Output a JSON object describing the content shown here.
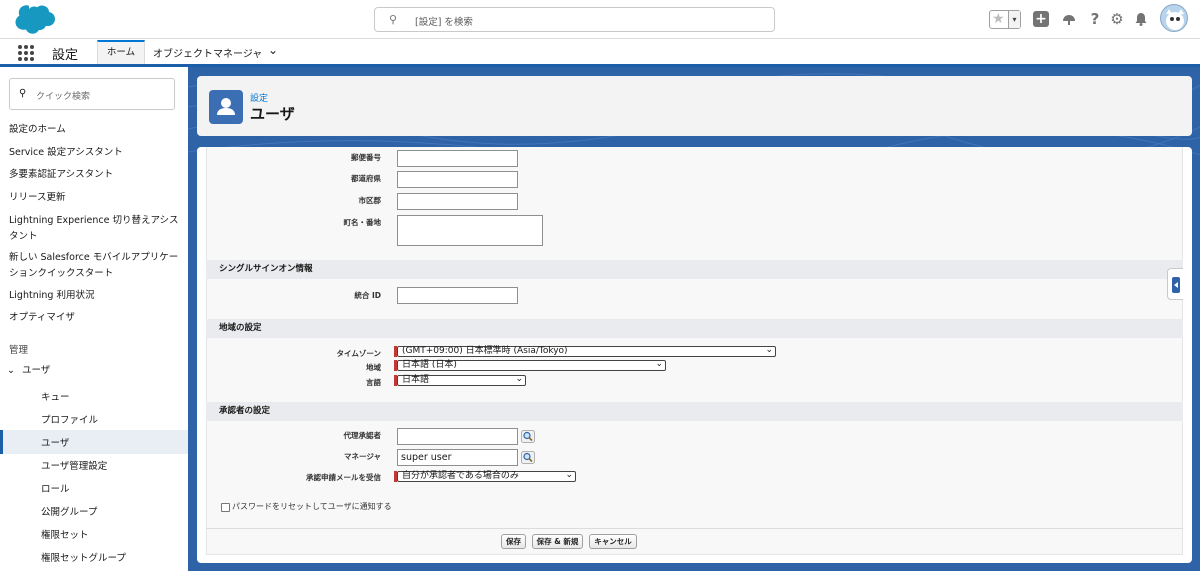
{
  "header": {
    "search_placeholder": "[設定] を検索",
    "icons": [
      "star-icon",
      "add-icon",
      "trailhead-icon",
      "help-icon",
      "gear-icon",
      "bell-icon",
      "avatar"
    ]
  },
  "navbar": {
    "app_name": "設定",
    "tabs": [
      {
        "label": "ホーム",
        "active": true
      },
      {
        "label": "オブジェクトマネージャ",
        "active": false
      }
    ]
  },
  "sidebar": {
    "search_placeholder": "クイック検索",
    "items": [
      {
        "label": "設定のホーム"
      },
      {
        "label": "Service 設定アシスタント"
      },
      {
        "label": "多要素認証アシスタント"
      },
      {
        "label": "リリース更新"
      },
      {
        "label": "Lightning Experience 切り替えアシスタント"
      },
      {
        "label": "新しい Salesforce モバイルアプリケーションクイックスタート"
      },
      {
        "label": "Lightning 利用状況"
      },
      {
        "label": "オプティマイザ"
      }
    ],
    "section_label": "管理",
    "group_label": "ユーザ",
    "sub_items": [
      {
        "label": "キュー"
      },
      {
        "label": "プロファイル"
      },
      {
        "label": "ユーザ",
        "active": true
      },
      {
        "label": "ユーザ管理設定"
      },
      {
        "label": "ロール"
      },
      {
        "label": "公開グループ"
      },
      {
        "label": "権限セット"
      },
      {
        "label": "権限セットグループ"
      }
    ]
  },
  "page_header": {
    "breadcrumb": "設定",
    "title": "ユーザ"
  },
  "form": {
    "address_fields": [
      {
        "label": "郵便番号",
        "value": ""
      },
      {
        "label": "都道府県",
        "value": ""
      },
      {
        "label": "市区郡",
        "value": ""
      },
      {
        "label": "町名・番地",
        "value": ""
      }
    ],
    "sso_section": {
      "title": "シングルサインオン情報",
      "federation_label": "統合 ID",
      "federation_value": ""
    },
    "locale_section": {
      "title": "地域の設定",
      "timezone_label": "タイムゾーン",
      "timezone_value": "(GMT+09:00) 日本標準時 (Asia/Tokyo)",
      "locale_label": "地域",
      "locale_value": "日本語 (日本)",
      "language_label": "言語",
      "language_value": "日本語"
    },
    "approver_section": {
      "title": "承認者の設定",
      "delegate_label": "代理承認者",
      "delegate_value": "",
      "manager_label": "マネージャ",
      "manager_value": "super user",
      "email_label": "承認申請メールを受信",
      "email_value": "自分が承認者である場合のみ"
    },
    "reset_password_label": "パスワードをリセットしてユーザに通知する",
    "reset_password_checked": false
  },
  "buttons": {
    "save": "保存",
    "save_new": "保存 & 新規",
    "cancel": "キャンセル"
  },
  "colors": {
    "brand_blue": "#2e63a8",
    "link_blue": "#0176d3",
    "required_red": "#c23934"
  }
}
